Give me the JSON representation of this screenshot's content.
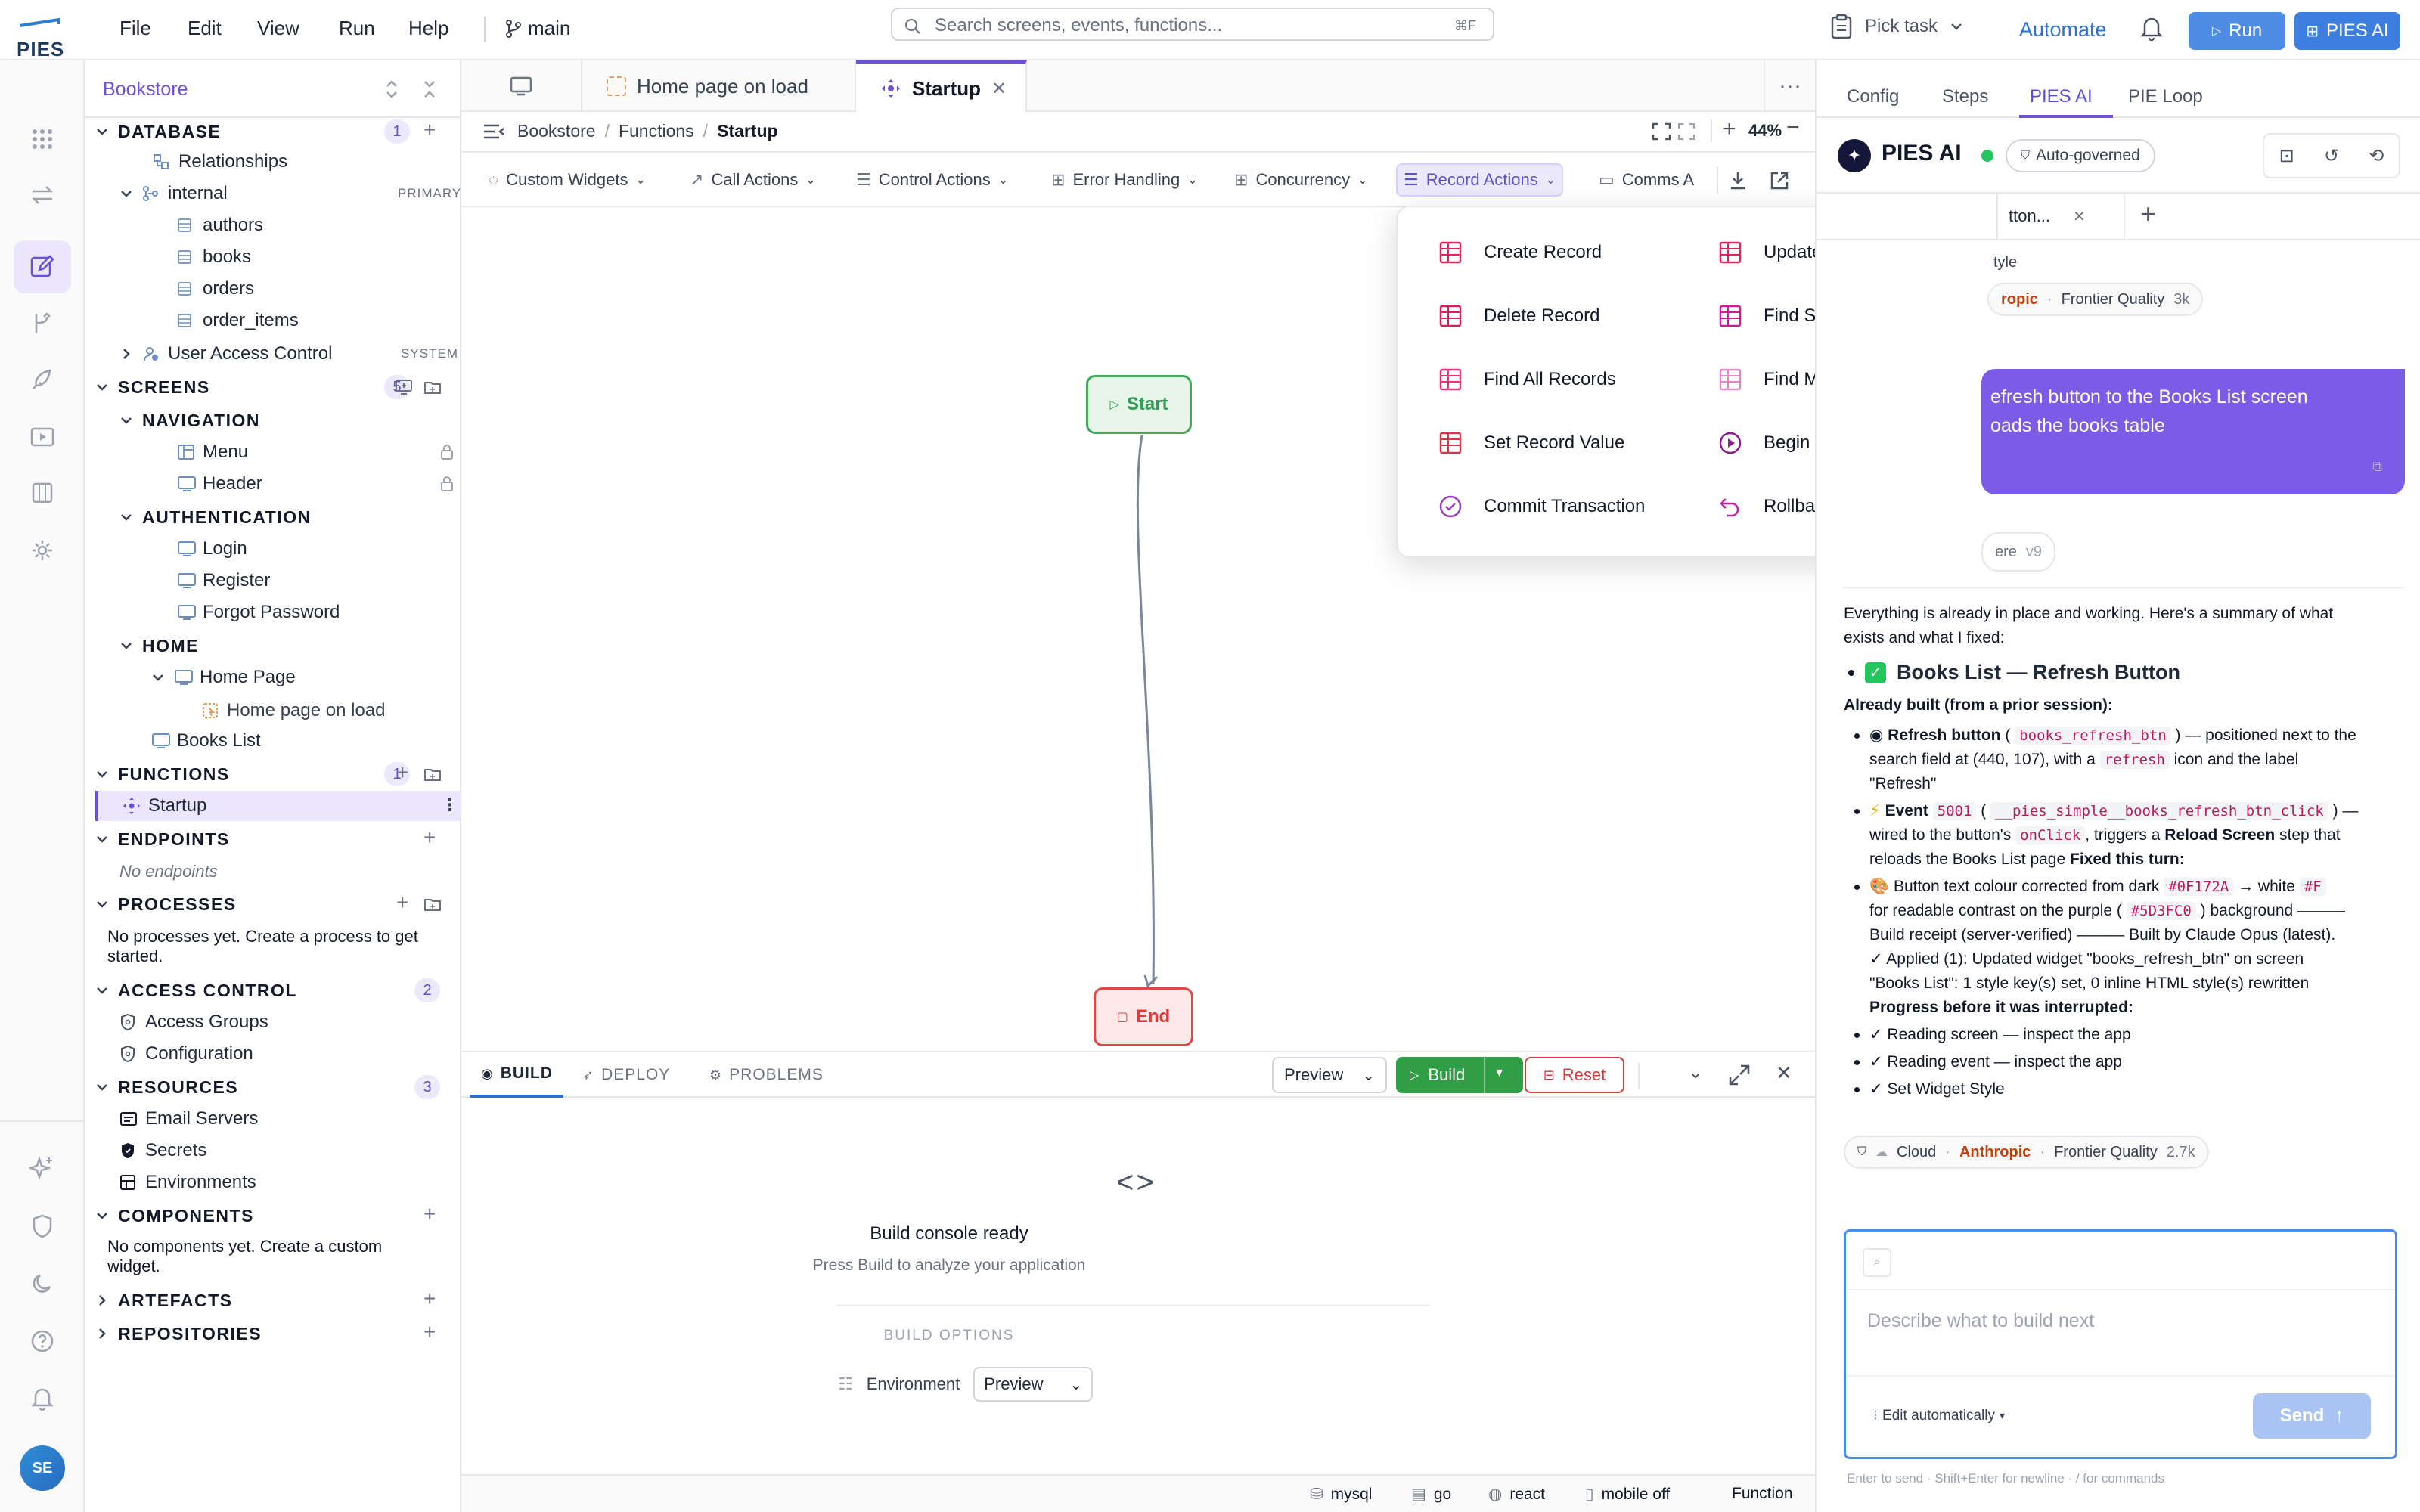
{
  "app": {
    "logo_text": "PIES"
  },
  "menu": [
    "File",
    "Edit",
    "View",
    "Run",
    "Help"
  ],
  "branch": "main",
  "search": {
    "placeholder": "Search screens, events, functions...",
    "shortcut": "⌘F"
  },
  "topright": {
    "pick_task": "Pick task",
    "automate": "Automate",
    "run": "Run",
    "pies_ai": "PIES AI"
  },
  "sidebar": {
    "project": "Bookstore",
    "database": {
      "label": "DATABASE",
      "count": "1",
      "relationships": "Relationships",
      "schema": "internal",
      "schema_tag": "PRIMARY",
      "tables": [
        "authors",
        "books",
        "orders",
        "order_items"
      ],
      "uac": "User Access Control",
      "uac_tag": "SYSTEM"
    },
    "screens": {
      "label": "SCREENS",
      "count": "5",
      "nav": "NAVIGATION",
      "menu": "Menu",
      "header": "Header",
      "auth": "AUTHENTICATION",
      "login": "Login",
      "register": "Register",
      "forgot": "Forgot Password",
      "home": "HOME",
      "home_page": "Home Page",
      "home_event": "Home page on load",
      "books_list": "Books List"
    },
    "functions": {
      "label": "FUNCTIONS",
      "count": "1",
      "startup": "Startup"
    },
    "endpoints": {
      "label": "ENDPOINTS",
      "empty": "No endpoints"
    },
    "processes": {
      "label": "PROCESSES",
      "empty_line1": "No processes yet. Create a process to get",
      "empty_line2": "started."
    },
    "access": {
      "label": "ACCESS CONTROL",
      "count": "2",
      "groups": "Access Groups",
      "config": "Configuration"
    },
    "resources": {
      "label": "RESOURCES",
      "count": "3",
      "email": "Email Servers",
      "secrets": "Secrets",
      "envs": "Environments"
    },
    "components": {
      "label": "COMPONENTS",
      "empty_line1": "No components yet. Create a custom",
      "empty_line2": "widget."
    },
    "artefacts": "ARTEFACTS",
    "repositories": "REPOSITORIES"
  },
  "tabs": {
    "tab2": "Home page on load",
    "tab3": "Startup"
  },
  "breadcrumb": {
    "b1": "Bookstore",
    "b2": "Functions",
    "b3": "Startup",
    "zoom": "44%"
  },
  "toolbar": {
    "custom_widgets": "Custom Widgets",
    "call_actions": "Call Actions",
    "control_actions": "Control Actions",
    "error_handling": "Error Handling",
    "concurrency": "Concurrency",
    "record_actions": "Record Actions",
    "comms": "Comms A"
  },
  "flow": {
    "start": "Start",
    "end": "End"
  },
  "record_menu": {
    "left": [
      "Create Record",
      "Delete Record",
      "Find All Records",
      "Set Record Value",
      "Commit Transaction"
    ],
    "right": [
      "Update Record",
      "Find Single Record",
      "Find Multiple Records",
      "Begin Transaction",
      "Rollback Transaction"
    ]
  },
  "bottom": {
    "build_tab": "BUILD",
    "deploy_tab": "DEPLOY",
    "problems_tab": "PROBLEMS",
    "preview": "Preview",
    "build_btn": "Build",
    "reset_btn": "Reset",
    "ready_title": "Build console ready",
    "ready_sub": "Press Build to analyze your application",
    "options": "BUILD OPTIONS",
    "env_label": "Environment",
    "env_value": "Preview"
  },
  "status": {
    "db": "mysql",
    "lang": "go",
    "ui": "react",
    "mobile": "mobile off",
    "kind": "Function"
  },
  "right": {
    "tabs": [
      "Config",
      "Steps",
      "PIES AI",
      "PIE Loop"
    ],
    "title": "PIES AI",
    "mode": "Auto-governed",
    "chat_tab": "tton...",
    "style_frag": "tyle",
    "chip1": {
      "provider": "ropic",
      "quality": "Frontier Quality",
      "tokens": "3k"
    },
    "user_msg_1": "efresh button to the Books List screen",
    "user_msg_2": "oads the books table",
    "version_frag": "ere",
    "version": "v9",
    "intro_1": "Everything is already in place and working. Here's a summary of what",
    "intro_2": "exists and what I fixed:",
    "heading": "Books List — Refresh Button",
    "already": "Already built (from a prior session):",
    "b1_label": "Refresh button",
    "b1_code": "books_refresh_btn",
    "b1_rest": ") — positioned next to the",
    "b1_line2a": "search field at (440, 107), with a",
    "b1_code2": "refresh",
    "b1_line2b": "icon and the label",
    "b1_line3": "\"Refresh\"",
    "b2_label": "Event",
    "b2_code": "5001",
    "b2_code2": "__pies_simple__books_refresh_btn_click",
    "b2_line2a": "wired to the button's",
    "b2_code3": "onClick",
    "b2_line2b": ", triggers a",
    "b2_bold": "Reload Screen",
    "b2_line2c": "step that",
    "b2_line3a": "reloads the Books List page",
    "b2_bold2": "Fixed this turn:",
    "b3_line1a": "Button text colour corrected from dark",
    "b3_code1": "#0F172A",
    "b3_line1b": "→ white",
    "b3_code2": "#F",
    "b3_line2a": "for readable contrast on the purple (",
    "b3_code3": "#5D3FC0",
    "b3_line2b": ") background ———",
    "b3_line3": "Build receipt (server-verified) ——— Built by Claude Opus (latest).",
    "b3_line4": "✓ Applied (1): Updated widget \"books_refresh_btn\" on screen",
    "b3_line5": "\"Books List\": 1 style key(s) set, 0 inline HTML style(s) rewritten",
    "b3_progress": "Progress before it was interrupted:",
    "b3_p1": "✓ Reading screen — inspect the app",
    "b3_p2": "✓ Reading event — inspect the app",
    "b3_p3": "✓ Set Widget Style",
    "chip2": {
      "cloud": "Cloud",
      "provider": "Anthropic",
      "quality": "Frontier Quality",
      "tokens": "2.7k"
    },
    "input_placeholder": "Describe what to build next",
    "edit_mode": "Edit automatically",
    "send": "Send",
    "hint": "Enter to send · Shift+Enter for newline · / for commands"
  },
  "avatar": "SE",
  "colors": {
    "accent": "#6d4fd8",
    "run_blue": "#4f8ce6",
    "start_green": "#2f9e55",
    "end_red": "#dc3b3b",
    "build_green": "#2f9e44"
  }
}
